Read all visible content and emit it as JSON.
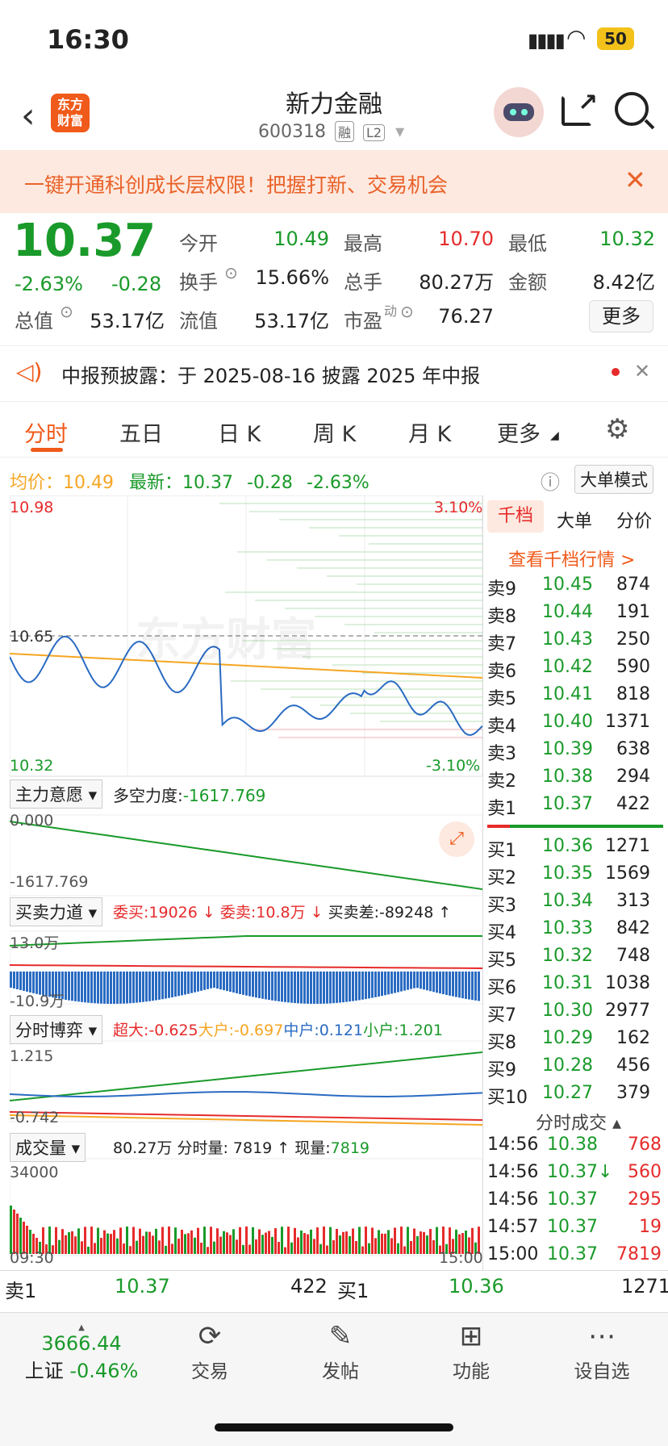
{
  "status": {
    "time": "16:30",
    "battery": "50"
  },
  "header": {
    "name": "新力金融",
    "code": "600318",
    "tag1": "融",
    "tag2": "L2",
    "logo": "东方\n财富"
  },
  "banner": {
    "text": "一键开通科创成长层权限！把握打新、交易机会"
  },
  "quote": {
    "price": "10.37",
    "pct": "-2.63%",
    "chg": "-0.28",
    "open_l": "今开",
    "open_v": "10.49",
    "high_l": "最高",
    "high_v": "10.70",
    "low_l": "最低",
    "low_v": "10.32",
    "turn_l": "换手",
    "turn_v": "15.66%",
    "vol_l": "总手",
    "vol_v": "80.27万",
    "amt_l": "金额",
    "amt_v": "8.42亿",
    "mcap_l": "总值",
    "mcap_v": "53.17亿",
    "float_l": "流值",
    "float_v": "53.17亿",
    "pe_l": "市盈",
    "pe_sup": "动",
    "pe_v": "76.27",
    "more": "更多"
  },
  "notice": {
    "text": "中报预披露：于 2025-08-16 披露 2025 年中报"
  },
  "tabs": [
    "分时",
    "五日",
    "日 K",
    "周 K",
    "月 K",
    "更多"
  ],
  "summary": {
    "avg_l": "均价：",
    "avg_v": "10.49",
    "last_l": "最新：",
    "last_v": "10.37",
    "chg": "-0.28",
    "pct": "-2.63%",
    "bigmode": "大单模式"
  },
  "chart": {
    "y_top": "10.98",
    "y_mid": "10.65",
    "y_bot": "10.32",
    "pct_top": "3.10%",
    "pct_bot": "-3.10%",
    "watermark": "东方财富"
  },
  "ind1": {
    "label": "主力意愿",
    "text_l": "多空力度:",
    "text_v": "-1617.769",
    "top": "0.000",
    "bot": "-1617.769"
  },
  "ind2": {
    "label": "买卖力道",
    "buy": "委买:19026 ↓",
    "sell": "委卖:10.8万 ↓",
    "diff": "买卖差:-89248 ↑",
    "top": "13.0万",
    "bot": "-10.9万"
  },
  "ind3": {
    "label": "分时博弈",
    "super": "超大:-0.625",
    "big": "大户:-0.697",
    "mid": "中户:0.121",
    "small": "小户:1.201",
    "top": "1.215",
    "bot": "-0.742"
  },
  "ind4": {
    "label": "成交量",
    "total": "80.27万",
    "seg": "分时量: 7819 ↑",
    "now_l": "现量:",
    "now_v": "7819",
    "max": "34000",
    "t_start": "09:30",
    "t_end": "15:00"
  },
  "panel": {
    "tabs": [
      "千档",
      "大单",
      "分价"
    ],
    "link": "查看千档行情 >",
    "sells": [
      [
        "卖9",
        "10.45",
        "874"
      ],
      [
        "卖8",
        "10.44",
        "191"
      ],
      [
        "卖7",
        "10.43",
        "250"
      ],
      [
        "卖6",
        "10.42",
        "590"
      ],
      [
        "卖5",
        "10.41",
        "818"
      ],
      [
        "卖4",
        "10.40",
        "1371"
      ],
      [
        "卖3",
        "10.39",
        "638"
      ],
      [
        "卖2",
        "10.38",
        "294"
      ],
      [
        "卖1",
        "10.37",
        "422"
      ]
    ],
    "buys": [
      [
        "买1",
        "10.36",
        "1271"
      ],
      [
        "买2",
        "10.35",
        "1569"
      ],
      [
        "买3",
        "10.34",
        "313"
      ],
      [
        "买4",
        "10.33",
        "842"
      ],
      [
        "买5",
        "10.32",
        "748"
      ],
      [
        "买6",
        "10.31",
        "1038"
      ],
      [
        "买7",
        "10.30",
        "2977"
      ],
      [
        "买8",
        "10.29",
        "162"
      ],
      [
        "买9",
        "10.28",
        "456"
      ],
      [
        "买10",
        "10.27",
        "379"
      ]
    ],
    "trades_title": "分时成交",
    "trades": [
      [
        "14:56",
        "10.38",
        "768"
      ],
      [
        "14:56",
        "10.37↓",
        "560"
      ],
      [
        "14:56",
        "10.37",
        "295"
      ],
      [
        "14:57",
        "10.37",
        "19"
      ],
      [
        "15:00",
        "10.37",
        "7819"
      ]
    ]
  },
  "bottom_quote": {
    "s1_l": "卖1",
    "s1_p": "10.37",
    "s1_v": "422",
    "b1_l": "买1",
    "b1_p": "10.36",
    "b1_v": "1271"
  },
  "nav": {
    "index_v": "3666.44",
    "index_l": "上证",
    "index_pct": "-0.46%",
    "trade": "交易",
    "post": "发帖",
    "func": "功能",
    "watch": "设自选"
  }
}
